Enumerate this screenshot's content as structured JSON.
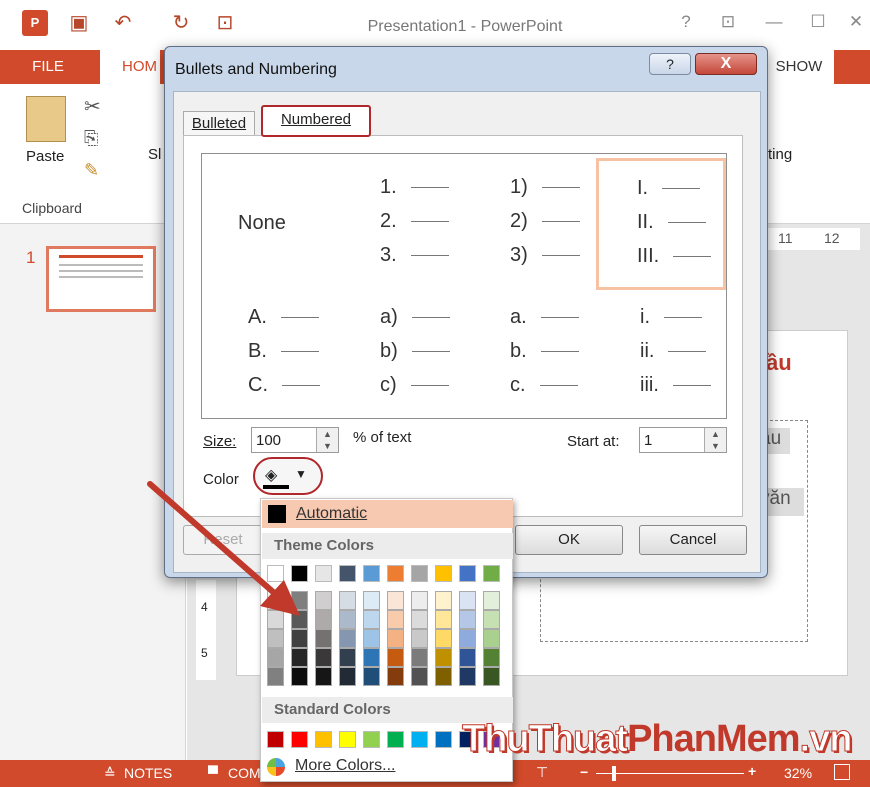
{
  "app": {
    "title": "Presentation1 - PowerPoint",
    "help": "?",
    "restore": "⊡",
    "minimize": "—",
    "maximize": "☐",
    "close": "✕"
  },
  "ribbon": {
    "tabs": {
      "file": "FILE",
      "home": "HOM",
      "show": "SHOW"
    },
    "paste": "Paste",
    "clipboard": "Clipboard",
    "partial_right": "ting",
    "partial_left": "Sl"
  },
  "slides": {
    "number": "1"
  },
  "ruler": [
    "11",
    "12"
  ],
  "slide_text": {
    "heading_fragment": "ầu",
    "box1": "ầu",
    "box2": "văn"
  },
  "vertical_ruler": [
    "4",
    "5"
  ],
  "status": {
    "notes": "NOTES",
    "comments": "COM",
    "zoom": "32%"
  },
  "dialog": {
    "title": "Bullets and Numbering",
    "help": "?",
    "close": "X",
    "tabs": {
      "bulleted": "Bulleted",
      "numbered": "Numbered"
    },
    "styles": [
      [
        "None"
      ],
      [
        "1.",
        "2.",
        "3."
      ],
      [
        "1)",
        "2)",
        "3)"
      ],
      [
        "I.",
        "II.",
        "III."
      ],
      [
        "A.",
        "B.",
        "C."
      ],
      [
        "a)",
        "b)",
        "c)"
      ],
      [
        "a.",
        "b.",
        "c."
      ],
      [
        "i.",
        "ii.",
        "iii."
      ]
    ],
    "size_label": "Size:",
    "size_value": "100",
    "pct_label": "% of text",
    "start_label": "Start at:",
    "start_value": "1",
    "color_label": "Color",
    "reset": "Reset",
    "ok": "OK",
    "cancel": "Cancel"
  },
  "color_menu": {
    "automatic": "Automatic",
    "theme_header": "Theme Colors",
    "standard_header": "Standard Colors",
    "more": "More Colors...",
    "theme_top": [
      "#ffffff",
      "#000000",
      "#e7e6e6",
      "#44546a",
      "#5b9bd5",
      "#ed7d31",
      "#a5a5a5",
      "#ffc000",
      "#4472c4",
      "#70ad47"
    ],
    "theme_shades": [
      [
        "#f2f2f2",
        "#d9d9d9",
        "#bfbfbf",
        "#a6a6a6",
        "#808080"
      ],
      [
        "#7f7f7f",
        "#595959",
        "#404040",
        "#262626",
        "#0d0d0d"
      ],
      [
        "#d0cece",
        "#aeaaaa",
        "#757171",
        "#3a3838",
        "#161616"
      ],
      [
        "#d6dce4",
        "#acb9ca",
        "#8496b0",
        "#323f4f",
        "#222a35"
      ],
      [
        "#ddebf7",
        "#bdd7ee",
        "#9dc3e6",
        "#2e75b6",
        "#1f4e79"
      ],
      [
        "#fbe5d6",
        "#f8cbad",
        "#f4b183",
        "#c55a11",
        "#843c0c"
      ],
      [
        "#ededed",
        "#dbdbdb",
        "#c9c9c9",
        "#7b7b7b",
        "#525252"
      ],
      [
        "#fff2cc",
        "#ffe699",
        "#ffd966",
        "#bf9000",
        "#7f6000"
      ],
      [
        "#dae3f3",
        "#b4c7e7",
        "#8faadc",
        "#2f5597",
        "#203864"
      ],
      [
        "#e2efda",
        "#c6e0b4",
        "#a9d08e",
        "#548235",
        "#385723"
      ]
    ],
    "standard": [
      "#c00000",
      "#ff0000",
      "#ffc000",
      "#ffff00",
      "#92d050",
      "#00b050",
      "#00b0f0",
      "#0070c0",
      "#002060",
      "#7030a0"
    ]
  },
  "watermark": {
    "part1": "ThuThuat",
    "part2": "PhanMem",
    "part3": ".vn"
  }
}
